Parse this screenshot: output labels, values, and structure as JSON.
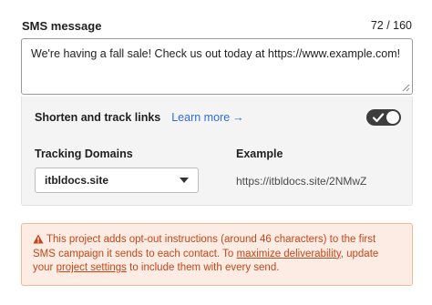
{
  "sms": {
    "label": "SMS message",
    "count": "72 / 160",
    "message": "We're having a fall sale! Check us out today at https://www.example.com!"
  },
  "tracking": {
    "shorten_label": "Shorten and track links",
    "learn_more": "Learn more",
    "learn_more_arrow": "→",
    "toggle_on": true,
    "domains_header": "Tracking Domains",
    "example_header": "Example",
    "selected_domain": "itbldocs.site",
    "example_url": "https://itbldocs.site/2NMwZ"
  },
  "warning": {
    "text_1": "This project adds opt-out instructions (around 46 characters) to the first SMS campaign it sends to each contact. To ",
    "link_1": "maximize deliverability",
    "text_2": ", update your ",
    "link_2": "project settings",
    "text_3": " to include them with every send."
  },
  "colors": {
    "accent": "#2d6cdf",
    "warning_text": "#c4471a",
    "warning_bg": "#fdece4",
    "toggle": "#3d3d3d"
  },
  "icons": {
    "warning": "warning-triangle-icon",
    "toggle_check": "check-icon",
    "dropdown": "chevron-down-icon"
  }
}
